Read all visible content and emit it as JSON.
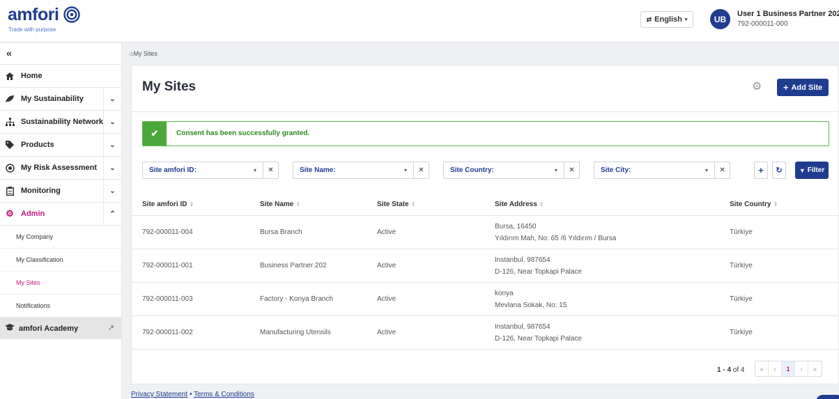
{
  "brand": {
    "name": "amfori",
    "tagline": "Trade with purpose"
  },
  "header": {
    "language": "English",
    "avatar_initials": "UB",
    "user_name": "User 1 Business Partner 202",
    "user_id": "792-000011-000"
  },
  "sidebar": {
    "collapse_glyph": "«",
    "items": [
      {
        "label": "Home",
        "icon": "home-icon"
      },
      {
        "label": "My Sustainability",
        "icon": "leaf-icon"
      },
      {
        "label": "Sustainability Network",
        "icon": "network-icon"
      },
      {
        "label": "Products",
        "icon": "tag-icon"
      },
      {
        "label": "My Risk Assessment",
        "icon": "risk-icon"
      },
      {
        "label": "Monitoring",
        "icon": "clipboard-icon"
      },
      {
        "label": "Admin",
        "icon": "gear-icon"
      }
    ],
    "admin_sub": [
      {
        "label": "My Company"
      },
      {
        "label": "My Classification"
      },
      {
        "label": "My Sites"
      },
      {
        "label": "Notifications"
      }
    ],
    "academy": {
      "label": "amfori Academy"
    }
  },
  "breadcrumb": "My Sites",
  "page": {
    "title": "My Sites",
    "add_button": "Add Site",
    "alert": "Consent has been successfully granted.",
    "filters": [
      {
        "label": "Site amfori ID:"
      },
      {
        "label": "Site Name:"
      },
      {
        "label": "Site Country:"
      },
      {
        "label": "Site City:"
      }
    ],
    "filter_button": "Filter"
  },
  "table": {
    "columns": [
      "Site amfori ID",
      "Site Name",
      "Site State",
      "Site Address",
      "Site Country"
    ],
    "rows": [
      {
        "id": "792-000011-004",
        "name": "Bursa Branch",
        "state": "Active",
        "addr1": "Bursa, 16450",
        "addr2": "Yıldırım Mah, No: 65 /6 Yıldırım / Bursa",
        "country": "Türkiye"
      },
      {
        "id": "792-000011-001",
        "name": "Business Partner 202",
        "state": "Active",
        "addr1": "Instanbul, 987654",
        "addr2": "D-126, Near Topkapi Palace",
        "country": "Türkiye"
      },
      {
        "id": "792-000011-003",
        "name": "Factory - Konya Branch",
        "state": "Active",
        "addr1": "konya",
        "addr2": "Mevlana Sokak, No: 15",
        "country": "Türkiye"
      },
      {
        "id": "792-000011-002",
        "name": "Manufacturing Utensils",
        "state": "Active",
        "addr1": "Instanbul, 987654",
        "addr2": "D-126, Near Topkapi Palace",
        "country": "Türkiye"
      }
    ]
  },
  "pagination": {
    "range": "1 - 4",
    "of_label": "of 4",
    "current_page": "1"
  },
  "footer": {
    "privacy": "Privacy Statement",
    "separator": "•",
    "terms": "Terms & Conditions"
  },
  "colors": {
    "brand": "#1f3c8f",
    "accent": "#c2157d",
    "success": "#4aa93a"
  }
}
